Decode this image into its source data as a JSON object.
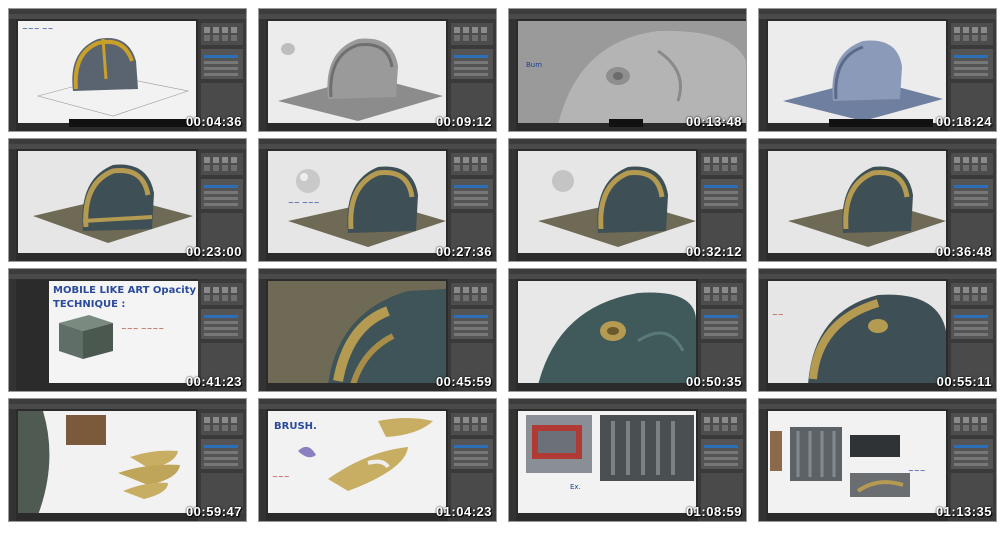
{
  "thumbnails": [
    {
      "timestamp": "00:04:36"
    },
    {
      "timestamp": "00:09:12"
    },
    {
      "timestamp": "00:13:48"
    },
    {
      "timestamp": "00:18:24"
    },
    {
      "timestamp": "00:23:00"
    },
    {
      "timestamp": "00:27:36"
    },
    {
      "timestamp": "00:32:12"
    },
    {
      "timestamp": "00:36:48"
    },
    {
      "timestamp": "00:41:23"
    },
    {
      "timestamp": "00:45:59"
    },
    {
      "timestamp": "00:50:35"
    },
    {
      "timestamp": "00:55:11"
    },
    {
      "timestamp": "00:59:47"
    },
    {
      "timestamp": "01:04:23"
    },
    {
      "timestamp": "01:08:59"
    },
    {
      "timestamp": "01:13:35"
    }
  ],
  "notes": {
    "t3_label": "Bum",
    "t9_title": "MOBILE LIKE ART Opacity 3",
    "t9_sub": "TECHNIQUE :",
    "t14_label": "BRUSH.",
    "t15_label": "Ex."
  }
}
